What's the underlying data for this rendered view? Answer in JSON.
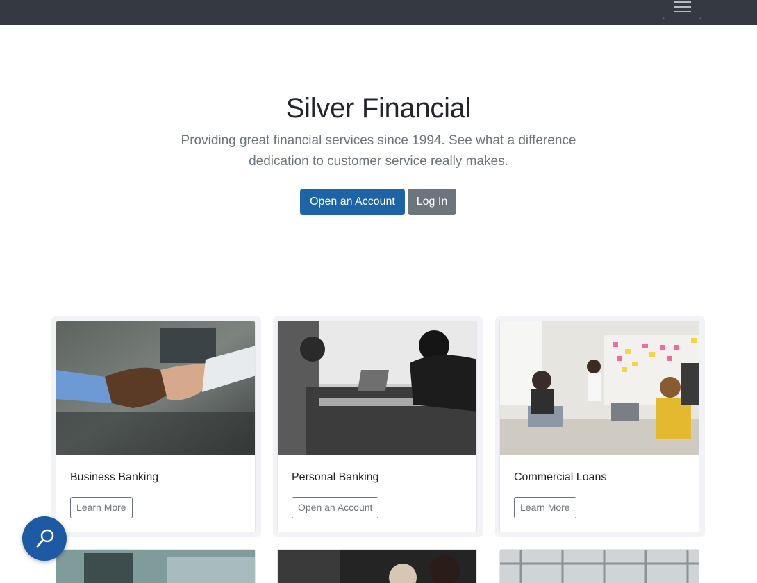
{
  "navbar": {
    "menu_icon": "hamburger-menu-icon"
  },
  "hero": {
    "title": "Silver Financial",
    "lead_line1": "Providing great financial services since 1994. See what a difference",
    "lead_line2": "dedication to customer service really makes.",
    "primary_button": "Open an Account",
    "secondary_button": "Log In"
  },
  "cards": [
    {
      "title": "Business Banking",
      "button": "Learn More",
      "image": "handshake-photo"
    },
    {
      "title": "Personal Banking",
      "button": "Open an Account",
      "image": "laptop-office-photo"
    },
    {
      "title": "Commercial Loans",
      "button": "Learn More",
      "image": "meeting-sticky-notes-photo"
    }
  ],
  "fab": {
    "icon": "search-icon"
  },
  "colors": {
    "navbar": "#343a40",
    "primary": "#1f63a7",
    "secondary": "#6c757d",
    "fab": "#1e5aa3"
  }
}
